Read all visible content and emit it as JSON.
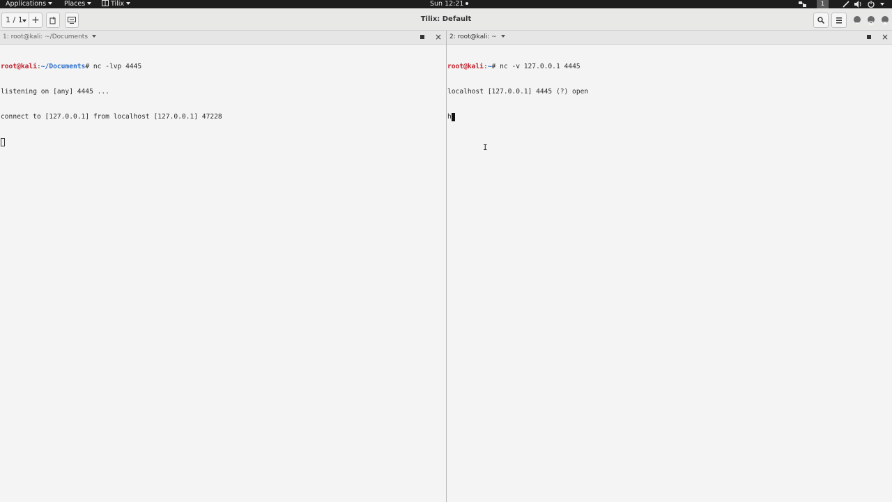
{
  "topbar": {
    "applications": "Applications",
    "places": "Places",
    "app_menu": "Tilix",
    "clock": "Sun 12:21",
    "workspace": "1"
  },
  "header": {
    "session_switcher": "1 / 1",
    "add_session": "+",
    "title": "Tilix: Default"
  },
  "panes": [
    {
      "title": "1: root@kali: ~/Documents",
      "lines": [
        {
          "user": "root@kali",
          "sep": ":",
          "path": "~/Documents",
          "cmd": "# nc -lvp 4445"
        },
        {
          "text": "listening on [any] 4445 ..."
        },
        {
          "text": "connect to [127.0.0.1] from localhost [127.0.0.1] 47228"
        }
      ]
    },
    {
      "title": "2: root@kali: ~",
      "lines": [
        {
          "user": "root@kali",
          "sep": ":",
          "path": "~",
          "cmd": "# nc -v 127.0.0.1 4445"
        },
        {
          "text": "localhost [127.0.0.1] 4445 (?) open"
        },
        {
          "text": "h"
        }
      ]
    }
  ],
  "colors": {
    "prompt_user": "#c01c28",
    "prompt_path": "#2a6bc8",
    "terminal_bg": "#f4f4f4",
    "topbar_bg": "#1d1d1d"
  }
}
